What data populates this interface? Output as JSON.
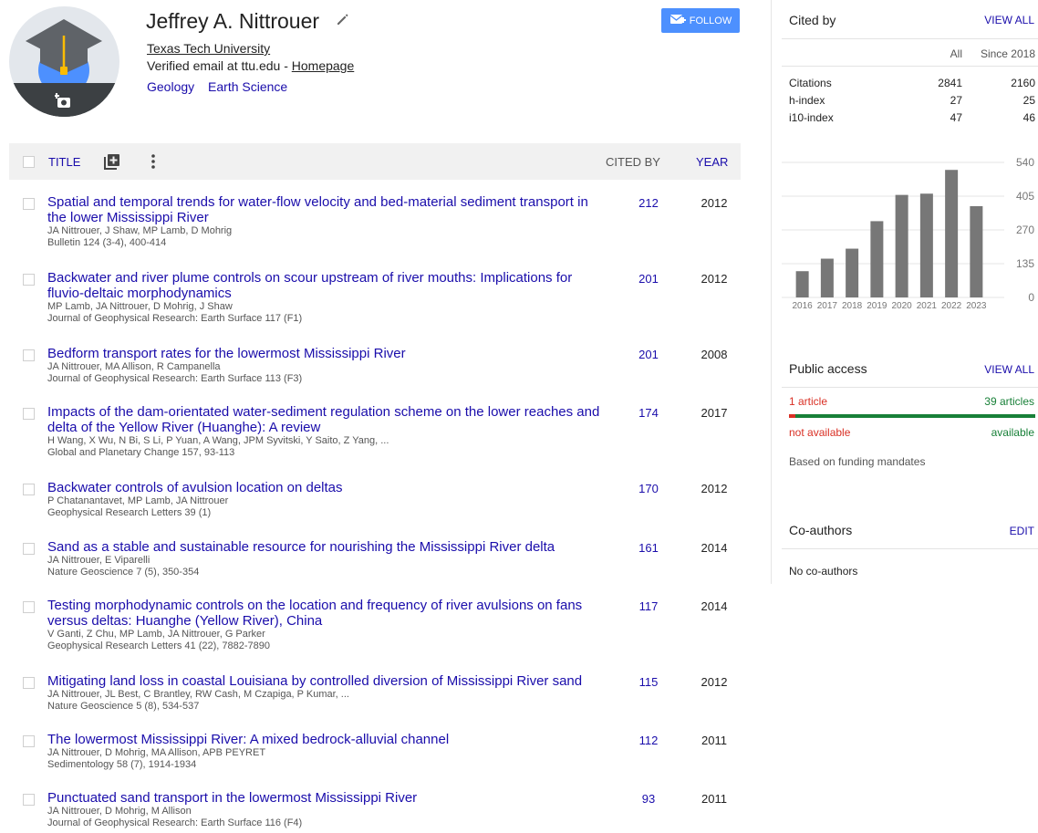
{
  "profile": {
    "name": "Jeffrey A. Nittrouer",
    "affiliation": "Texas Tech University",
    "email_text": "Verified email at ttu.edu - ",
    "homepage_label": "Homepage",
    "interests": [
      "Geology",
      "Earth Science"
    ],
    "follow_label": "FOLLOW"
  },
  "table_header": {
    "title": "TITLE",
    "cited_by": "CITED BY",
    "year": "YEAR"
  },
  "articles": [
    {
      "title": "Spatial and temporal trends for water-flow velocity and bed-material sediment transport in the lower Mississippi River",
      "authors": "JA Nittrouer, J Shaw, MP Lamb, D Mohrig",
      "venue": "Bulletin 124 (3-4), 400-414",
      "cited": "212",
      "year": "2012"
    },
    {
      "title": "Backwater and river plume controls on scour upstream of river mouths: Implications for fluvio-deltaic morphodynamics",
      "authors": "MP Lamb, JA Nittrouer, D Mohrig, J Shaw",
      "venue": "Journal of Geophysical Research: Earth Surface 117 (F1)",
      "cited": "201",
      "year": "2012"
    },
    {
      "title": "Bedform transport rates for the lowermost Mississippi River",
      "authors": "JA Nittrouer, MA Allison, R Campanella",
      "venue": "Journal of Geophysical Research: Earth Surface 113 (F3)",
      "cited": "201",
      "year": "2008"
    },
    {
      "title": "Impacts of the dam-orientated water-sediment regulation scheme on the lower reaches and delta of the Yellow River (Huanghe): A review",
      "authors": "H Wang, X Wu, N Bi, S Li, P Yuan, A Wang, JPM Syvitski, Y Saito, Z Yang, ...",
      "venue": "Global and Planetary Change 157, 93-113",
      "cited": "174",
      "year": "2017"
    },
    {
      "title": "Backwater controls of avulsion location on deltas",
      "authors": "P Chatanantavet, MP Lamb, JA Nittrouer",
      "venue": "Geophysical Research Letters 39 (1)",
      "cited": "170",
      "year": "2012"
    },
    {
      "title": "Sand as a stable and sustainable resource for nourishing the Mississippi River delta",
      "authors": "JA Nittrouer, E Viparelli",
      "venue": "Nature Geoscience 7 (5), 350-354",
      "cited": "161",
      "year": "2014"
    },
    {
      "title": "Testing morphodynamic controls on the location and frequency of river avulsions on fans versus deltas: Huanghe (Yellow River), China",
      "authors": "V Ganti, Z Chu, MP Lamb, JA Nittrouer, G Parker",
      "venue": "Geophysical Research Letters 41 (22), 7882-7890",
      "cited": "117",
      "year": "2014"
    },
    {
      "title": "Mitigating land loss in coastal Louisiana by controlled diversion of Mississippi River sand",
      "authors": "JA Nittrouer, JL Best, C Brantley, RW Cash, M Czapiga, P Kumar, ...",
      "venue": "Nature Geoscience 5 (8), 534-537",
      "cited": "115",
      "year": "2012"
    },
    {
      "title": "The lowermost Mississippi River: A mixed bedrock-alluvial channel",
      "authors": "JA Nittrouer, D Mohrig, MA Allison, APB PEYRET",
      "venue": "Sedimentology 58 (7), 1914-1934",
      "cited": "112",
      "year": "2011"
    },
    {
      "title": "Punctuated sand transport in the lowermost Mississippi River",
      "authors": "JA Nittrouer, D Mohrig, M Allison",
      "venue": "Journal of Geophysical Research: Earth Surface 116 (F4)",
      "cited": "93",
      "year": "2011"
    }
  ],
  "cited_by": {
    "heading": "Cited by",
    "view_all": "VIEW ALL",
    "col_all": "All",
    "col_since": "Since 2018",
    "rows": [
      {
        "label": "Citations",
        "all": "2841",
        "since": "2160"
      },
      {
        "label": "h-index",
        "all": "27",
        "since": "25"
      },
      {
        "label": "i10-index",
        "all": "47",
        "since": "46"
      }
    ]
  },
  "chart_data": {
    "type": "bar",
    "categories": [
      "2016",
      "2017",
      "2018",
      "2019",
      "2020",
      "2021",
      "2022",
      "2023"
    ],
    "values": [
      105,
      155,
      195,
      305,
      410,
      415,
      510,
      365
    ],
    "ylim": [
      0,
      540
    ],
    "yticks": [
      0,
      135,
      270,
      405,
      540
    ],
    "bar_color": "#777777",
    "grid": true,
    "axis_side": "right"
  },
  "public_access": {
    "heading": "Public access",
    "view_all": "VIEW ALL",
    "left_count": "1 article",
    "right_count": "39 articles",
    "left_label": "not available",
    "right_label": "available",
    "note": "Based on funding mandates",
    "available_fraction": 0.975
  },
  "coauthors": {
    "heading": "Co-authors",
    "edit": "EDIT",
    "empty": "No co-authors"
  },
  "colors": {
    "link": "#1a0dab",
    "follow": "#4d90fe",
    "red": "#d93025",
    "green": "#188038"
  }
}
